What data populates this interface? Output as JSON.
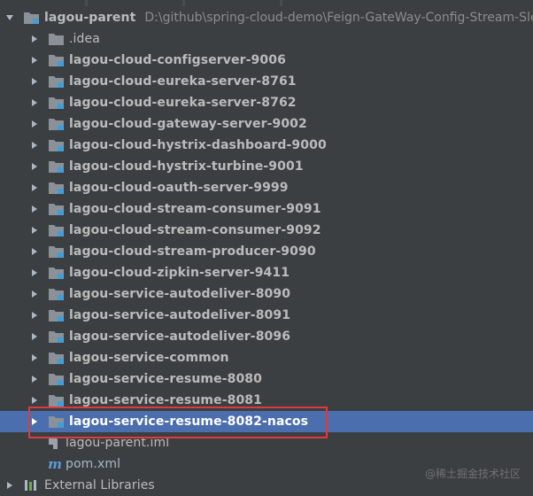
{
  "project": {
    "name": "lagou-parent",
    "path": "D:\\github\\spring-cloud-demo\\Feign-GateWay-Config-Stream-Sleu"
  },
  "modules": [
    {
      "label": ".idea",
      "bold": false
    },
    {
      "label": "lagou-cloud-configserver-9006",
      "bold": true
    },
    {
      "label": "lagou-cloud-eureka-server-8761",
      "bold": true
    },
    {
      "label": "lagou-cloud-eureka-server-8762",
      "bold": true
    },
    {
      "label": "lagou-cloud-gateway-server-9002",
      "bold": true
    },
    {
      "label": "lagou-cloud-hystrix-dashboard-9000",
      "bold": true
    },
    {
      "label": "lagou-cloud-hystrix-turbine-9001",
      "bold": true
    },
    {
      "label": "lagou-cloud-oauth-server-9999",
      "bold": true
    },
    {
      "label": "lagou-cloud-stream-consumer-9091",
      "bold": true
    },
    {
      "label": "lagou-cloud-stream-consumer-9092",
      "bold": true
    },
    {
      "label": "lagou-cloud-stream-producer-9090",
      "bold": true
    },
    {
      "label": "lagou-cloud-zipkin-server-9411",
      "bold": true
    },
    {
      "label": "lagou-service-autodeliver-8090",
      "bold": true
    },
    {
      "label": "lagou-service-autodeliver-8091",
      "bold": true
    },
    {
      "label": "lagou-service-autodeliver-8096",
      "bold": true
    },
    {
      "label": "lagou-service-common",
      "bold": true
    },
    {
      "label": "lagou-service-resume-8080",
      "bold": true
    },
    {
      "label": "lagou-service-resume-8081",
      "bold": true
    },
    {
      "label": "lagou-service-resume-8082-nacos",
      "bold": true,
      "selected": true
    }
  ],
  "files": {
    "iml": "lagou-parent.iml",
    "pom": "pom.xml"
  },
  "external_libraries": "External Libraries",
  "watermark": "@稀土掘金技术社区",
  "colors": {
    "background": "#3c3f41",
    "selection": "#4b6eaf",
    "highlight_box": "#e0393e",
    "module_marker": "#3d9fd9"
  },
  "icons": {
    "expand": "chevron-down-icon",
    "collapse": "chevron-right-icon",
    "module": "module-folder-icon",
    "folder": "folder-icon",
    "iml_file": "iml-file-icon",
    "maven": "maven-m-icon",
    "libraries": "libraries-icon"
  }
}
